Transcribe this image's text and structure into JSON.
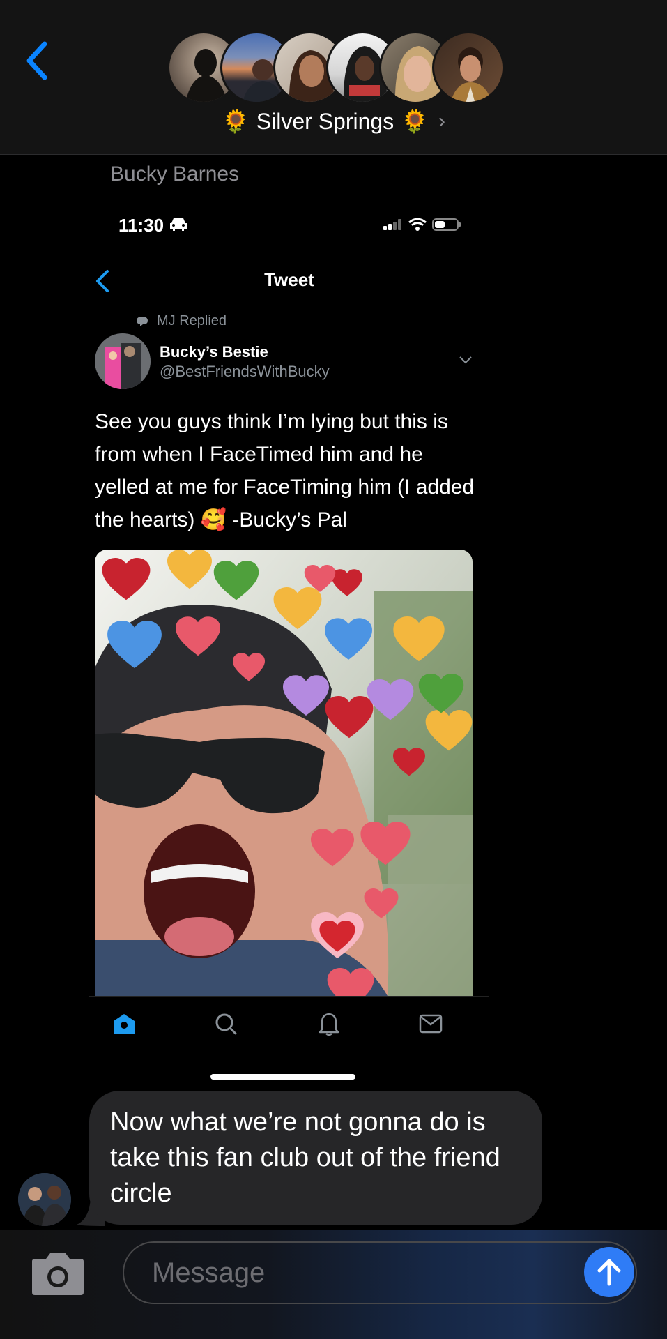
{
  "header": {
    "group_name": "Silver Springs",
    "title_emoji": "🌻",
    "avatars": [
      "avatar-1",
      "avatar-2",
      "avatar-3",
      "avatar-4",
      "avatar-5",
      "avatar-6"
    ]
  },
  "message": {
    "sender": "Bucky Barnes"
  },
  "screenshot": {
    "status_time": "11:30",
    "nav_title": "Tweet",
    "replied_label": "MJ Replied",
    "author_name": "Bucky’s Bestie",
    "author_handle": "@BestFriendsWithBucky",
    "tweet_text": "See you guys think I’m lying but this is from when I FaceTimed him and he yelled at me for FaceTiming him (I added the hearts) 🥰 -Bucky’s Pal",
    "tabs": [
      "home-icon",
      "search-icon",
      "bell-icon",
      "mail-icon"
    ]
  },
  "bubble": {
    "text": "Now what we’re not gonna do is take this fan club out of the friend circle"
  },
  "composer": {
    "placeholder": "Message"
  },
  "colors": {
    "accent": "#0a84ff",
    "send_button": "#2f7cf6",
    "bubble_bg": "#262628",
    "header_bg": "#141414"
  }
}
